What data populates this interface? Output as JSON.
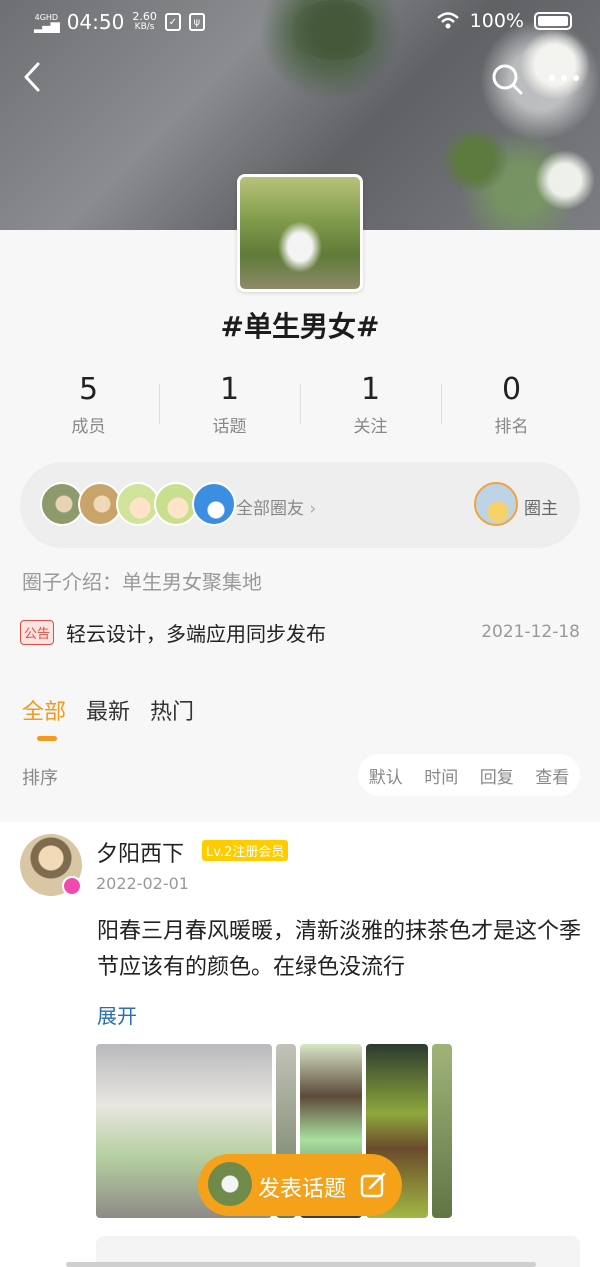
{
  "status_bar": {
    "network": "4GHD",
    "time": "04:50",
    "speed_value": "2.60",
    "speed_unit": "KB/s",
    "battery_percent": "100%"
  },
  "nav": {
    "back_icon": "back-chevron-icon",
    "search_icon": "search-icon",
    "more_icon": "more-dots-icon"
  },
  "circle": {
    "title": "#单生男女#",
    "stats": [
      {
        "value": "5",
        "label": "成员"
      },
      {
        "value": "1",
        "label": "话题"
      },
      {
        "value": "1",
        "label": "关注"
      },
      {
        "value": "0",
        "label": "排名"
      }
    ],
    "all_friends_label": "全部圈友",
    "owner_label": "圈主",
    "intro": "圈子介绍：单生男女聚集地",
    "notice": {
      "tag": "公告",
      "text": "轻云设计，多端应用同步发布",
      "date": "2021-12-18"
    }
  },
  "tabs": [
    {
      "label": "全部",
      "active": true
    },
    {
      "label": "最新",
      "active": false
    },
    {
      "label": "热门",
      "active": false
    }
  ],
  "sort": {
    "label": "排序",
    "options": [
      "默认",
      "时间",
      "回复",
      "查看"
    ]
  },
  "post": {
    "author": "夕阳西下",
    "level_badge": "Lv.2注册会员",
    "date": "2022-02-01",
    "body": "阳春三月春风暖暖，清新淡雅的抹茶色才是这个季节应该有的颜色。在绿色没流行",
    "expand_label": "展开"
  },
  "fab": {
    "label": "发表话题",
    "icon": "edit-icon"
  },
  "colors": {
    "accent": "#f29a1c",
    "fab": "#f5a21a",
    "notice_red": "#e64b3b",
    "level_yellow": "#ffcc00",
    "link_blue": "#2a6fb3"
  }
}
